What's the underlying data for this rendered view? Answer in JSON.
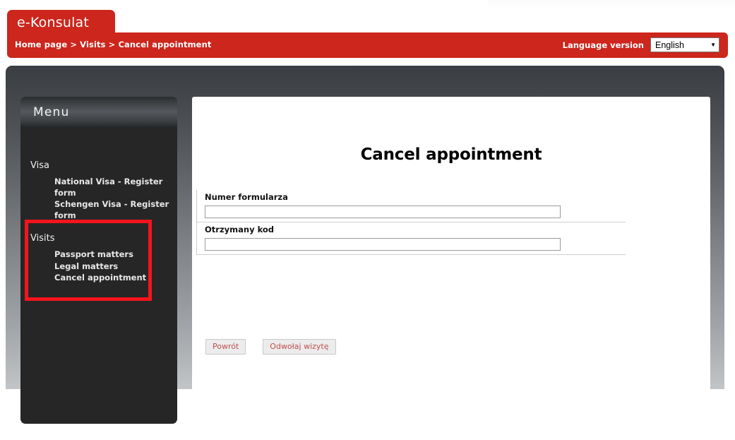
{
  "brand": {
    "name": "e-Konsulat"
  },
  "header": {
    "breadcrumb": "Home page > Visits > Cancel appointment",
    "language_label": "Language version",
    "language_value": "English",
    "dropdown_arrow": "▼",
    "red": "#cc261d"
  },
  "sidebar": {
    "title": "Menu",
    "groups": [
      {
        "title": "Visa",
        "items": [
          "National Visa - Register form",
          "Schengen Visa - Register form"
        ]
      },
      {
        "title": "Visits",
        "items": [
          "Passport matters",
          "Legal matters",
          "Cancel appointment"
        ]
      }
    ]
  },
  "annotation": {
    "color": "#f4141b"
  },
  "main": {
    "title": "Cancel appointment",
    "fields": [
      {
        "label": "Numer formularza",
        "value": "",
        "placeholder": ""
      },
      {
        "label": "Otrzymany kod",
        "value": "",
        "placeholder": ""
      }
    ],
    "buttons": [
      {
        "label": "Powrót"
      },
      {
        "label": "Odwołaj wizytę"
      }
    ],
    "button_text_color": "#c0504d"
  }
}
